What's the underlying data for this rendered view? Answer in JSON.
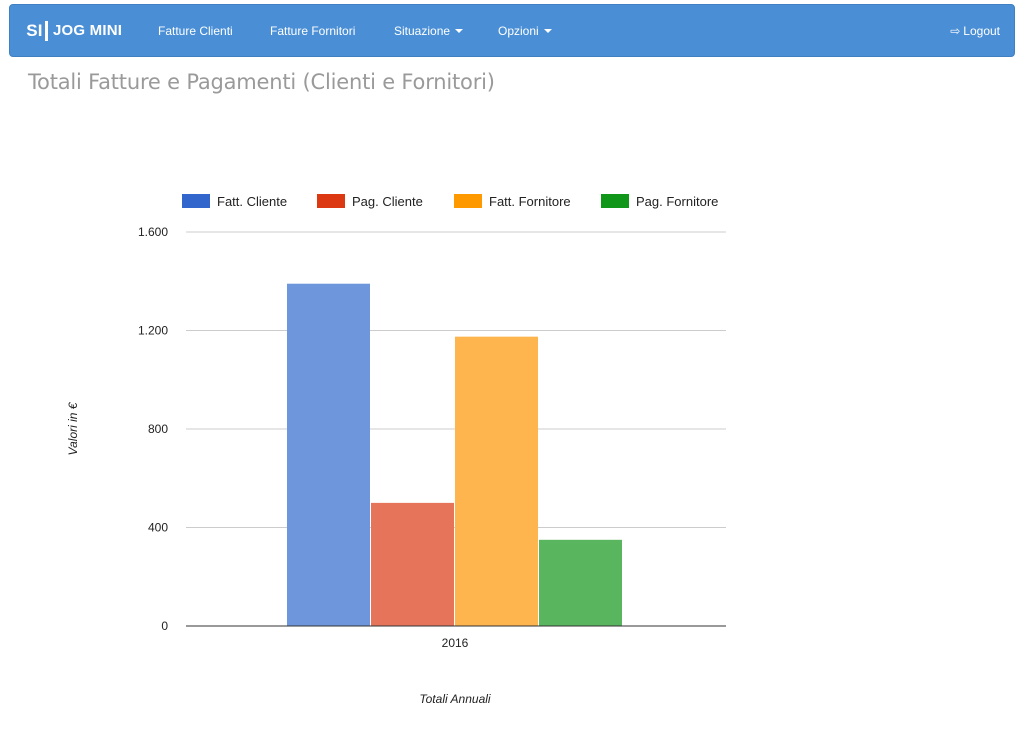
{
  "navbar": {
    "brand_logo": "SI",
    "brand_text": "JOG MINI",
    "items": [
      {
        "label": "Fatture Clienti"
      },
      {
        "label": "Fatture Fornitori"
      },
      {
        "label": "Situazione",
        "dropdown": true
      },
      {
        "label": "Opzioni",
        "dropdown": true
      }
    ],
    "logout_label": "Logout",
    "logout_icon": "logout-icon"
  },
  "page_title": "Totali Fatture e Pagamenti (Clienti e Fornitori)",
  "colors": {
    "navbar": "#4a8fd6",
    "legend": [
      "#3366cc",
      "#dc3912",
      "#ff9900",
      "#109618"
    ],
    "bars": [
      "#6d96dc",
      "#e6745a",
      "#ffb54d",
      "#5ab55f"
    ]
  },
  "chart_data": {
    "type": "bar",
    "categories": [
      "2016"
    ],
    "series": [
      {
        "name": "Fatt. Cliente",
        "values": [
          1390
        ]
      },
      {
        "name": "Pag. Cliente",
        "values": [
          500
        ]
      },
      {
        "name": "Fatt. Fornitore",
        "values": [
          1175
        ]
      },
      {
        "name": "Pag. Fornitore",
        "values": [
          350
        ]
      }
    ],
    "ylim": [
      0,
      1600
    ],
    "yticks": [
      0,
      400,
      800,
      1200,
      1600
    ],
    "ytick_labels": [
      "0",
      "400",
      "800",
      "1.200",
      "1.600"
    ],
    "ylabel": "Valori in €",
    "xlabel": "Totali Annuali",
    "legend_position": "top",
    "grid": true
  }
}
